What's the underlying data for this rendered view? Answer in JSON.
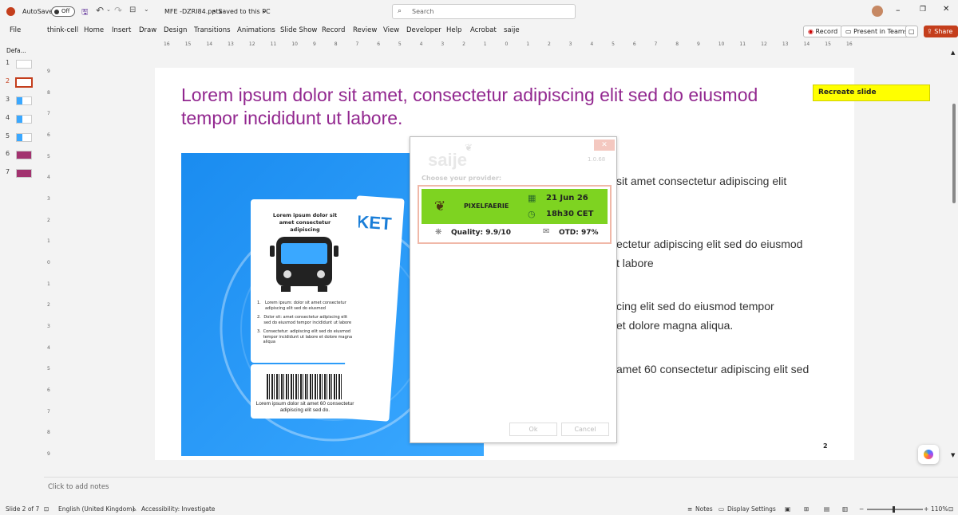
{
  "titlebar": {
    "autosave_label": "AutoSave",
    "autosave_state": "Off",
    "filename": "MFE -DZRI84.pptx",
    "save_status": "• Saved to this PC",
    "search_placeholder": "Search"
  },
  "menu": {
    "items": [
      "File",
      "think-cell",
      "Home",
      "Insert",
      "Draw",
      "Design",
      "Transitions",
      "Animations",
      "Slide Show",
      "Record",
      "Review",
      "View",
      "Developer",
      "Help",
      "Acrobat",
      "saije"
    ],
    "record_button": "Record",
    "present_button": "Present in Teams",
    "share_button": "Share"
  },
  "ruler": {
    "h_ticks": [
      "16",
      "15",
      "14",
      "13",
      "12",
      "11",
      "10",
      "9",
      "8",
      "7",
      "6",
      "5",
      "4",
      "3",
      "2",
      "1",
      "0",
      "1",
      "2",
      "3",
      "4",
      "5",
      "6",
      "7",
      "8",
      "9",
      "10",
      "11",
      "12",
      "13",
      "14",
      "15",
      "16"
    ],
    "v_ticks": [
      "9",
      "8",
      "7",
      "6",
      "5",
      "4",
      "3",
      "2",
      "1",
      "0",
      "1",
      "2",
      "3",
      "4",
      "5",
      "6",
      "7",
      "8",
      "9"
    ]
  },
  "thumbnails": {
    "section_label": "Defa...",
    "numbers": [
      "1",
      "2",
      "3",
      "4",
      "5",
      "6",
      "7"
    ]
  },
  "slide": {
    "title": "Lorem ipsum dolor sit amet, consectetur adipiscing elit sed do eiusmod tempor incididunt ut labore.",
    "bullets": [
      "sit amet consectetur adipiscing elit",
      "ectetur adipiscing elit sed do eiusmod",
      "t labore",
      "cing elit sed do eiusmod tempor",
      "et dolore magna aliqua.",
      "amet 60 consectetur adipiscing elit sed"
    ],
    "page_number": "2",
    "ticket": {
      "header": "Lorem ipsum dolor sit amet consectetur adipiscing",
      "list": [
        {
          "n": "1.",
          "text": "Lorem ipsum: dolor sit amet consectetur adipiscing elit sed do eiusmod"
        },
        {
          "n": "2.",
          "text": "Dolor sit: amet consectetur adipiscing elit sed do eiusmod tempor incididunt ut labore"
        },
        {
          "n": "3.",
          "text": "Consectetur: adipiscing elit sed do eiusmod tempor incididunt ut labore et dolore magna aliqua"
        }
      ],
      "footer": "Lorem ipsum dolor sit amet 60 consectetur adipiscing elit sed do.",
      "ket_text": "KET"
    }
  },
  "dialog": {
    "logo": "saije",
    "version": "1.0.68",
    "choose_label": "Choose your provider:",
    "provider": {
      "name": "PIXELFAERIE",
      "date": "21 Jun 26",
      "time": "18h30 CET",
      "quality": "Quality: 9.9/10",
      "otd": "OTD: 97%"
    },
    "ok_button": "Ok",
    "cancel_button": "Cancel",
    "close_glyph": "✕"
  },
  "sticky": {
    "label": "Recreate slide"
  },
  "notes": {
    "placeholder": "Click to add notes"
  },
  "status": {
    "slide_info": "Slide 2 of 7",
    "language": "English (United Kingdom)",
    "accessibility": "Accessibility: Investigate",
    "notes": "Notes",
    "display_settings": "Display Settings",
    "zoom": "110%"
  },
  "colors": {
    "title": "#92278f",
    "provider_bg": "#7ed321",
    "sticky": "#ffff00",
    "share": "#c43e1c"
  }
}
